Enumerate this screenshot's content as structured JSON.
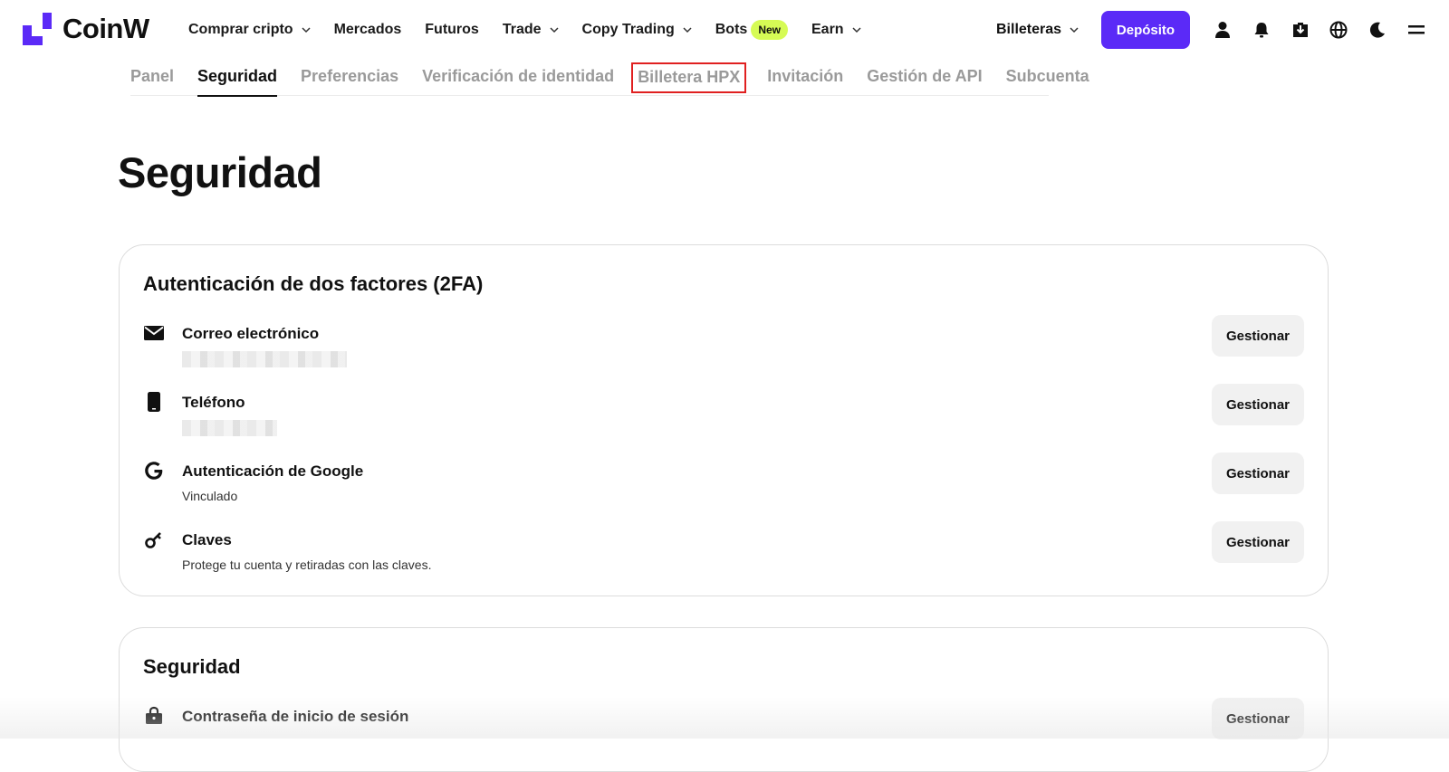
{
  "brand": {
    "name": "CoinW",
    "accent": "#5b2af7"
  },
  "nav": {
    "items": [
      {
        "label": "Comprar cripto",
        "dropdown": true
      },
      {
        "label": "Mercados"
      },
      {
        "label": "Futuros"
      },
      {
        "label": "Trade",
        "dropdown": true
      },
      {
        "label": "Copy Trading",
        "dropdown": true
      },
      {
        "label": "Bots",
        "badge": "New"
      },
      {
        "label": "Earn",
        "dropdown": true
      }
    ],
    "wallets_label": "Billeteras",
    "deposit_label": "Depósito",
    "icons": [
      "user-icon",
      "bell-icon",
      "download-icon",
      "globe-icon",
      "moon-icon",
      "menu-icon"
    ]
  },
  "subnav": {
    "tabs": [
      {
        "label": "Panel"
      },
      {
        "label": "Seguridad",
        "active": true
      },
      {
        "label": "Preferencias"
      },
      {
        "label": "Verificación de identidad"
      },
      {
        "label": "Billetera HPX",
        "highlighted": true
      },
      {
        "label": "Invitación"
      },
      {
        "label": "Gestión de API"
      },
      {
        "label": "Subcuenta"
      }
    ]
  },
  "page": {
    "title": "Seguridad"
  },
  "twofa": {
    "title": "Autenticación de dos factores (2FA)",
    "rows": [
      {
        "icon": "mail-icon",
        "label": "Correo electrónico",
        "sub": "",
        "button": "Gestionar"
      },
      {
        "icon": "phone-icon",
        "label": "Teléfono",
        "sub": "",
        "button": "Gestionar"
      },
      {
        "icon": "google-icon",
        "label": "Autenticación de Google",
        "sub": "Vinculado",
        "button": "Gestionar"
      },
      {
        "icon": "key-icon",
        "label": "Claves",
        "sub": "Protege tu cuenta y retiradas con las claves.",
        "button": "Gestionar"
      }
    ]
  },
  "security": {
    "title": "Seguridad",
    "rows": [
      {
        "icon": "lock-icon",
        "label": "Contraseña de inicio de sesión",
        "button": "Gestionar"
      }
    ]
  }
}
